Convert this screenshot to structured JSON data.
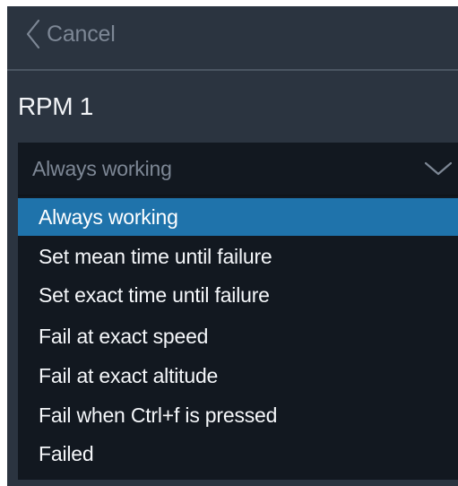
{
  "header": {
    "back_label": "Cancel",
    "back_icon": "chevron-left-icon"
  },
  "section": {
    "title": "RPM 1"
  },
  "select": {
    "value": "Always working",
    "chevron_icon": "chevron-down-icon",
    "options": [
      {
        "label": "Always working",
        "selected": true
      },
      {
        "label": "Set mean time until failure",
        "selected": false
      },
      {
        "label": "Set exact time until failure",
        "selected": false
      },
      {
        "label": "Fail at exact speed",
        "selected": false
      },
      {
        "label": "Fail at exact altitude",
        "selected": false
      },
      {
        "label": "Fail when Ctrl+f is pressed",
        "selected": false
      },
      {
        "label": "Failed",
        "selected": false
      }
    ]
  },
  "colors": {
    "panel_background": "#2b3440",
    "dropdown_background": "#121820",
    "selected_highlight": "#1f73ab",
    "muted_text": "#7d8795",
    "primary_text": "#f5f7fa"
  }
}
